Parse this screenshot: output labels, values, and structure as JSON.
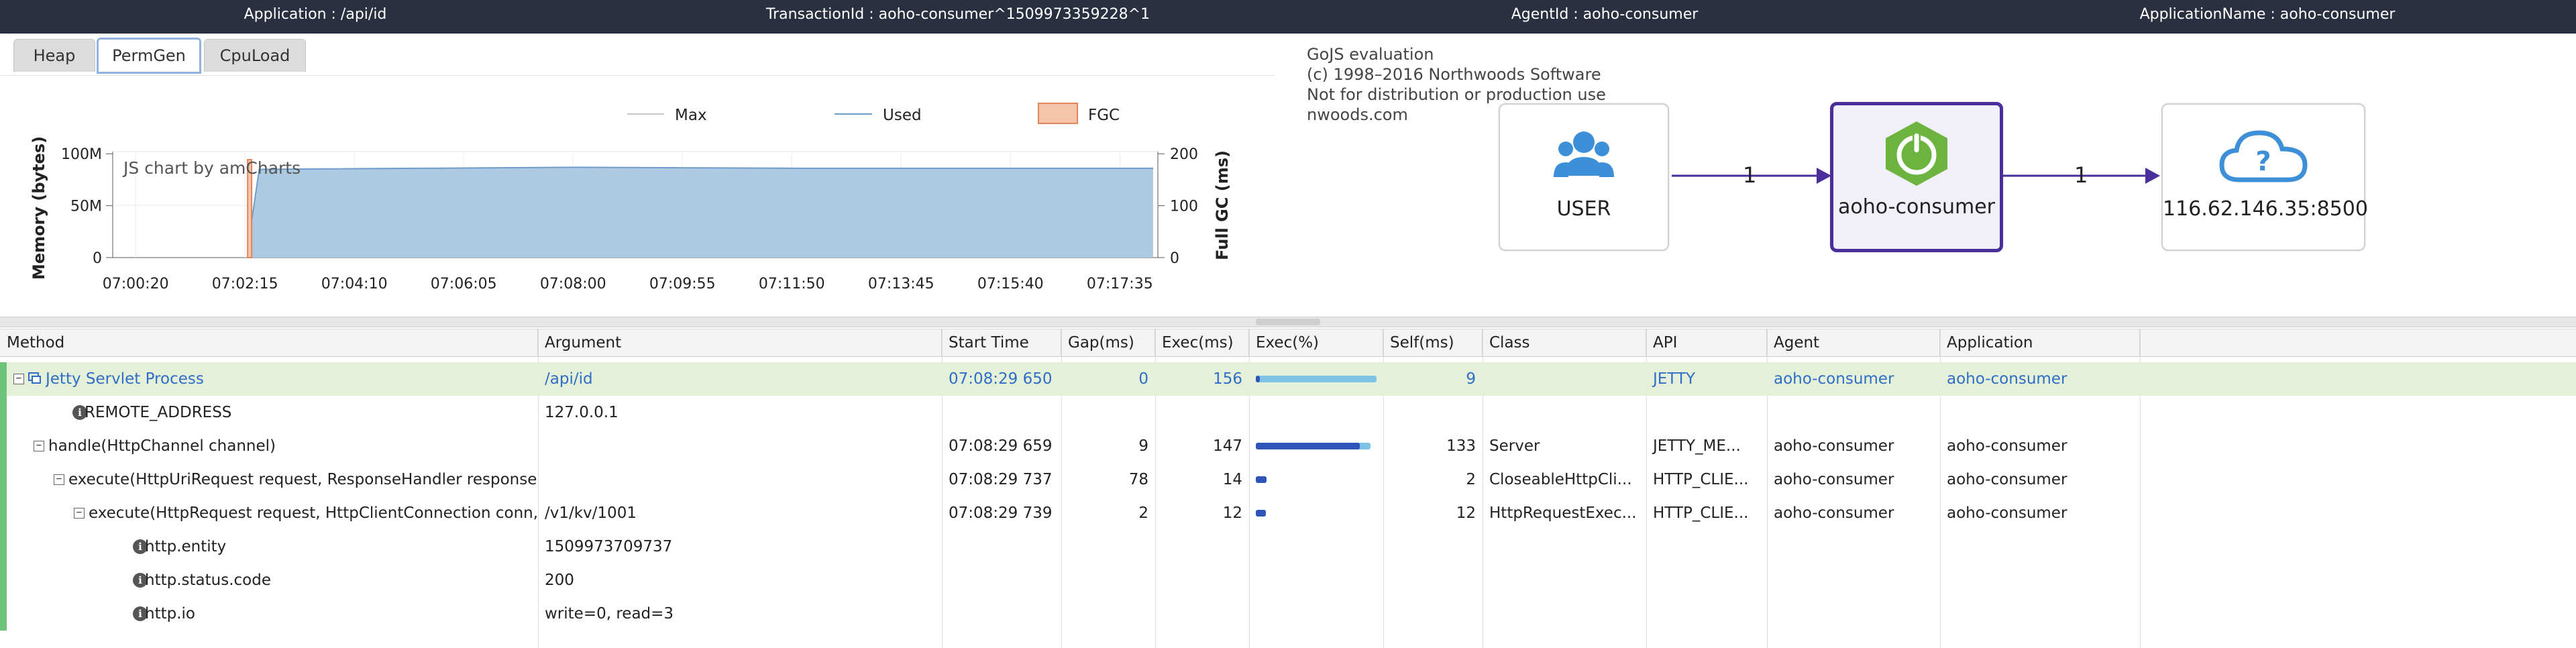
{
  "header": {
    "application": "Application : /api/id",
    "transaction": "TransactionId : aoho-consumer^1509973359228^1",
    "agent": "AgentId : aoho-consumer",
    "app_name": "ApplicationName : aoho-consumer"
  },
  "tabs": [
    {
      "label": "Heap",
      "active": false
    },
    {
      "label": "PermGen",
      "active": true
    },
    {
      "label": "CpuLoad",
      "active": false
    }
  ],
  "chart_data": {
    "type": "area",
    "watermark": "JS chart by amCharts",
    "legend": [
      "Max",
      "Used",
      "FGC"
    ],
    "legend_placement": "top",
    "ylabel_left": "Memory (bytes)",
    "ylabel_right": "Full GC (ms)",
    "y_left_ticks": [
      "100M",
      "50M",
      "0"
    ],
    "y_right_ticks": [
      "200",
      "100",
      "0"
    ],
    "x_ticks": [
      "07:00:20",
      "07:02:15",
      "07:04:10",
      "07:06:05",
      "07:08:00",
      "07:09:55",
      "07:11:50",
      "07:13:45",
      "07:15:40",
      "07:17:35"
    ],
    "colors": {
      "used": "#a9c7e0",
      "used_line": "#6e9ccc",
      "fgc": "#f6c4a8",
      "fgc_border": "#e0875c"
    },
    "series": [
      {
        "name": "Used",
        "x": [
          "07:02:22",
          "07:02:30",
          "07:08:00",
          "07:12:00",
          "07:18:10"
        ],
        "values": [
          35,
          85,
          87,
          86,
          86
        ]
      }
    ]
  },
  "gojs": {
    "note_lines": [
      "GoJS evaluation",
      "(c) 1998–2016 Northwoods Software",
      "Not for distribution or production use",
      "nwoods.com"
    ],
    "nodes": [
      {
        "label": "USER",
        "icon": "users-icon"
      },
      {
        "label": "aoho-consumer",
        "icon": "spring-boot-icon"
      },
      {
        "label": "116.62.146.35:8500",
        "icon": "cloud-question-icon"
      }
    ],
    "edges": [
      {
        "label": "1"
      },
      {
        "label": "1"
      }
    ],
    "colors": {
      "accent": "#4a2f9c",
      "user_icon": "#3d8fd8",
      "spring": "#6db33f"
    }
  },
  "table": {
    "columns": [
      "Method",
      "Argument",
      "Start Time",
      "Gap(ms)",
      "Exec(ms)",
      "Exec(%)",
      "Self(ms)",
      "Class",
      "API",
      "Agent",
      "Application"
    ],
    "rows": [
      {
        "method": "Jetty Servlet Process",
        "argument": "/api/id",
        "start": "07:08:29 650",
        "gap": "0",
        "exec": "156",
        "pct": 0.99,
        "self": "9",
        "class": "",
        "api": "JETTY",
        "agent": "aoho-consumer",
        "app": "aoho-consumer"
      },
      {
        "method": "REMOTE_ADDRESS",
        "argument": "127.0.0.1",
        "start": "",
        "gap": "",
        "exec": "",
        "pct": 0,
        "self": "",
        "class": "",
        "api": "",
        "agent": "",
        "app": ""
      },
      {
        "method": "handle(HttpChannel channel)",
        "argument": "",
        "start": "07:08:29 659",
        "gap": "9",
        "exec": "147",
        "pct": 0.94,
        "self": "133",
        "class": "Server",
        "api": "JETTY_ME...",
        "agent": "aoho-consumer",
        "app": "aoho-consumer"
      },
      {
        "method": "execute(HttpUriRequest request, ResponseHandler responseH",
        "argument": "",
        "start": "07:08:29 737",
        "gap": "78",
        "exec": "14",
        "pct": 0.09,
        "self": "2",
        "class": "CloseableHttpCli...",
        "api": "HTTP_CLIE...",
        "agent": "aoho-consumer",
        "app": "aoho-consumer"
      },
      {
        "method": "execute(HttpRequest request, HttpClientConnection conn, H",
        "argument": "/v1/kv/1001",
        "start": "07:08:29 739",
        "gap": "2",
        "exec": "12",
        "pct": 0.08,
        "self": "12",
        "class": "HttpRequestExec...",
        "api": "HTTP_CLIE...",
        "agent": "aoho-consumer",
        "app": "aoho-consumer"
      },
      {
        "method": "http.entity",
        "argument": "1509973709737",
        "start": "",
        "gap": "",
        "exec": "",
        "pct": 0,
        "self": "",
        "class": "",
        "api": "",
        "agent": "",
        "app": ""
      },
      {
        "method": "http.status.code",
        "argument": "200",
        "start": "",
        "gap": "",
        "exec": "",
        "pct": 0,
        "self": "",
        "class": "",
        "api": "",
        "agent": "",
        "app": ""
      },
      {
        "method": "http.io",
        "argument": "write=0, read=3",
        "start": "",
        "gap": "",
        "exec": "",
        "pct": 0,
        "self": "",
        "class": "",
        "api": "",
        "agent": "",
        "app": ""
      }
    ]
  }
}
